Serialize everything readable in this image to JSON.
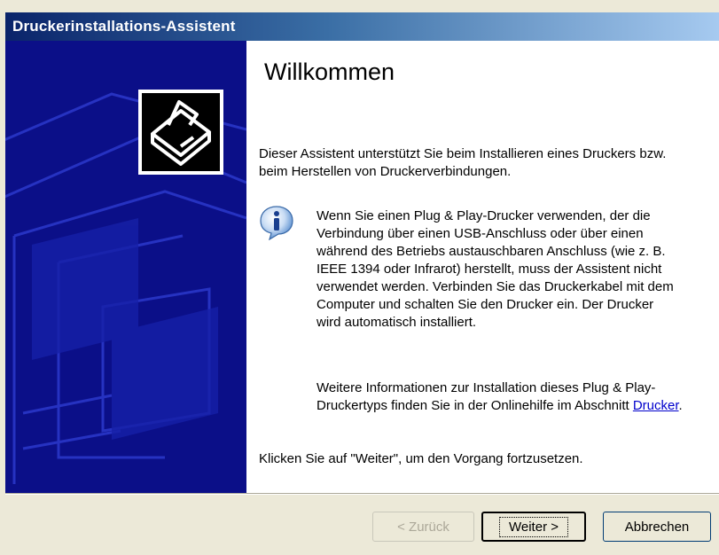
{
  "window": {
    "title": "Druckerinstallations-Assistent"
  },
  "main": {
    "heading": "Willkommen",
    "intro": "Dieser Assistent unterstützt Sie beim Installieren eines Druckers bzw. beim Herstellen von Druckerverbindungen.",
    "info": "Wenn Sie einen Plug & Play-Drucker verwenden, der die Verbindung über einen USB-Anschluss oder über einen während des Betriebs austauschbaren Anschluss (wie z. B. IEEE 1394 oder Infrarot) herstellt, muss der Assistent nicht verwendet werden. Verbinden Sie das Druckerkabel mit dem Computer und schalten Sie den Drucker ein. Der Drucker wird automatisch installiert.",
    "more_info_prefix": "Weitere Informationen zur Installation dieses Plug & Play-Druckertyps finden Sie in der Onlinehilfe im Abschnitt ",
    "more_info_link": "Drucker",
    "more_info_suffix": ".",
    "continue_hint": "Klicken Sie auf \"Weiter\", um den Vorgang fortzusetzen."
  },
  "buttons": {
    "back": "< Zurück",
    "next": "Weiter >",
    "cancel": "Abbrechen"
  },
  "icons": {
    "sidebar_logo": "printer-icon",
    "info": "info-icon"
  },
  "colors": {
    "sidebar_bg": "#0b0f88",
    "titlebar_start": "#0a246a",
    "link": "#0000cc"
  }
}
